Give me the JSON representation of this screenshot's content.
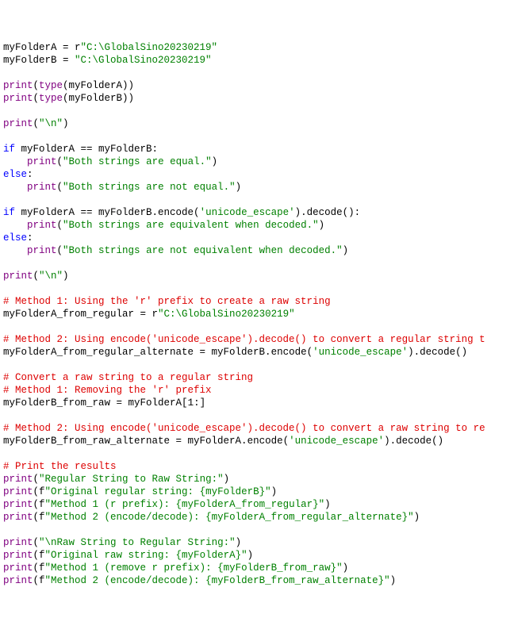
{
  "lines": [
    [
      [
        "id",
        "myFolderA"
      ],
      [
        "op",
        " = r"
      ],
      [
        "str",
        "\"C:\\GlobalSino20230219\""
      ]
    ],
    [
      [
        "id",
        "myFolderB"
      ],
      [
        "op",
        " = "
      ],
      [
        "str",
        "\"C:\\GlobalSino20230219\""
      ]
    ],
    [],
    [
      [
        "bi",
        "print"
      ],
      [
        "op",
        "("
      ],
      [
        "bi",
        "type"
      ],
      [
        "op",
        "(myFolderA))"
      ]
    ],
    [
      [
        "bi",
        "print"
      ],
      [
        "op",
        "("
      ],
      [
        "bi",
        "type"
      ],
      [
        "op",
        "(myFolderB))"
      ]
    ],
    [],
    [
      [
        "bi",
        "print"
      ],
      [
        "op",
        "("
      ],
      [
        "str",
        "\"\\n\""
      ],
      [
        "op",
        ")"
      ]
    ],
    [],
    [
      [
        "kw",
        "if"
      ],
      [
        "op",
        " myFolderA == myFolderB:"
      ]
    ],
    [
      [
        "op",
        "    "
      ],
      [
        "bi",
        "print"
      ],
      [
        "op",
        "("
      ],
      [
        "str",
        "\"Both strings are equal.\""
      ],
      [
        "op",
        ")"
      ]
    ],
    [
      [
        "kw",
        "else"
      ],
      [
        "op",
        ":"
      ]
    ],
    [
      [
        "op",
        "    "
      ],
      [
        "bi",
        "print"
      ],
      [
        "op",
        "("
      ],
      [
        "str",
        "\"Both strings are not equal.\""
      ],
      [
        "op",
        ")"
      ]
    ],
    [],
    [
      [
        "kw",
        "if"
      ],
      [
        "op",
        " myFolderA == myFolderB.encode("
      ],
      [
        "str",
        "'unicode_escape'"
      ],
      [
        "op",
        ").decode():"
      ]
    ],
    [
      [
        "op",
        "    "
      ],
      [
        "bi",
        "print"
      ],
      [
        "op",
        "("
      ],
      [
        "str",
        "\"Both strings are equivalent when decoded.\""
      ],
      [
        "op",
        ")"
      ]
    ],
    [
      [
        "kw",
        "else"
      ],
      [
        "op",
        ":"
      ]
    ],
    [
      [
        "op",
        "    "
      ],
      [
        "bi",
        "print"
      ],
      [
        "op",
        "("
      ],
      [
        "str",
        "\"Both strings are not equivalent when decoded.\""
      ],
      [
        "op",
        ")"
      ]
    ],
    [],
    [
      [
        "bi",
        "print"
      ],
      [
        "op",
        "("
      ],
      [
        "str",
        "\"\\n\""
      ],
      [
        "op",
        ")"
      ]
    ],
    [],
    [
      [
        "cm",
        "# Method 1: Using the 'r' prefix to create a raw string"
      ]
    ],
    [
      [
        "id",
        "myFolderA_from_regular"
      ],
      [
        "op",
        " = r"
      ],
      [
        "str",
        "\"C:\\GlobalSino20230219\""
      ]
    ],
    [],
    [
      [
        "cm",
        "# Method 2: Using encode('unicode_escape').decode() to convert a regular string t"
      ]
    ],
    [
      [
        "id",
        "myFolderA_from_regular_alternate"
      ],
      [
        "op",
        " = myFolderB.encode("
      ],
      [
        "str",
        "'unicode_escape'"
      ],
      [
        "op",
        ").decode()"
      ]
    ],
    [],
    [
      [
        "cm",
        "# Convert a raw string to a regular string"
      ]
    ],
    [
      [
        "cm",
        "# Method 1: Removing the 'r' prefix"
      ]
    ],
    [
      [
        "id",
        "myFolderB_from_raw"
      ],
      [
        "op",
        " = myFolderA["
      ],
      [
        "num",
        "1"
      ],
      [
        "op",
        ":]"
      ]
    ],
    [],
    [
      [
        "cm",
        "# Method 2: Using encode('unicode_escape').decode() to convert a raw string to re"
      ]
    ],
    [
      [
        "id",
        "myFolderB_from_raw_alternate"
      ],
      [
        "op",
        " = myFolderA.encode("
      ],
      [
        "str",
        "'unicode_escape'"
      ],
      [
        "op",
        ").decode()"
      ]
    ],
    [],
    [
      [
        "cm",
        "# Print the results"
      ]
    ],
    [
      [
        "bi",
        "print"
      ],
      [
        "op",
        "("
      ],
      [
        "str",
        "\"Regular String to Raw String:\""
      ],
      [
        "op",
        ")"
      ]
    ],
    [
      [
        "bi",
        "print"
      ],
      [
        "op",
        "(f"
      ],
      [
        "str",
        "\"Original regular string: {myFolderB}\""
      ],
      [
        "op",
        ")"
      ]
    ],
    [
      [
        "bi",
        "print"
      ],
      [
        "op",
        "(f"
      ],
      [
        "str",
        "\"Method 1 (r prefix): {myFolderA_from_regular}\""
      ],
      [
        "op",
        ")"
      ]
    ],
    [
      [
        "bi",
        "print"
      ],
      [
        "op",
        "(f"
      ],
      [
        "str",
        "\"Method 2 (encode/decode): {myFolderA_from_regular_alternate}\""
      ],
      [
        "op",
        ")"
      ]
    ],
    [],
    [
      [
        "bi",
        "print"
      ],
      [
        "op",
        "("
      ],
      [
        "str",
        "\"\\nRaw String to Regular String:\""
      ],
      [
        "op",
        ")"
      ]
    ],
    [
      [
        "bi",
        "print"
      ],
      [
        "op",
        "(f"
      ],
      [
        "str",
        "\"Original raw string: {myFolderA}\""
      ],
      [
        "op",
        ")"
      ]
    ],
    [
      [
        "bi",
        "print"
      ],
      [
        "op",
        "(f"
      ],
      [
        "str",
        "\"Method 1 (remove r prefix): {myFolderB_from_raw}\""
      ],
      [
        "op",
        ")"
      ]
    ],
    [
      [
        "bi",
        "print"
      ],
      [
        "op",
        "(f"
      ],
      [
        "str",
        "\"Method 2 (encode/decode): {myFolderB_from_raw_alternate}\""
      ],
      [
        "op",
        ")"
      ]
    ]
  ]
}
